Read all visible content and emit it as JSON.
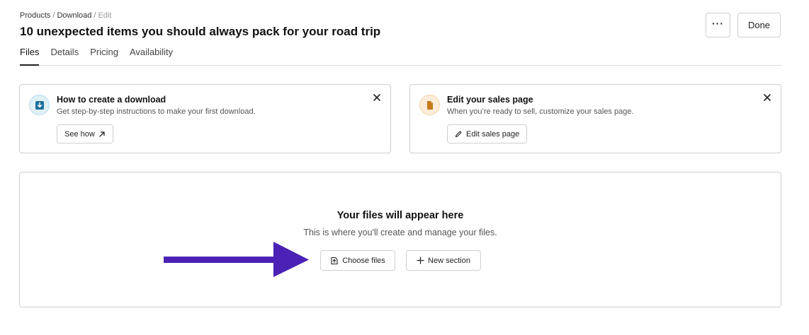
{
  "breadcrumb": {
    "items": [
      "Products",
      "Download"
    ],
    "current": "Edit",
    "separator": "/"
  },
  "page": {
    "title": "10 unexpected items you should always pack for your road trip"
  },
  "header": {
    "more_label": "···",
    "done_label": "Done"
  },
  "tabs": [
    {
      "label": "Files",
      "active": true
    },
    {
      "label": "Details",
      "active": false
    },
    {
      "label": "Pricing",
      "active": false
    },
    {
      "label": "Availability",
      "active": false
    }
  ],
  "cards": [
    {
      "title": "How to create a download",
      "description": "Get step-by-step instructions to make your first download.",
      "button_label": "See how",
      "icon": "download-icon",
      "button_icon": "arrow-up-right-icon",
      "accent": "#1e6f9e"
    },
    {
      "title": "Edit your sales page",
      "description": "When you’re ready to sell, customize your sales page.",
      "button_label": "Edit sales page",
      "icon": "document-icon",
      "button_icon": "pencil-icon",
      "accent": "#c77a1a"
    }
  ],
  "files": {
    "title": "Your files will appear here",
    "description": "This is where you'll create and manage your files.",
    "choose_label": "Choose files",
    "new_section_label": "New section"
  },
  "colors": {
    "arrow": "#4b22b5",
    "border": "#cfcfcf"
  }
}
